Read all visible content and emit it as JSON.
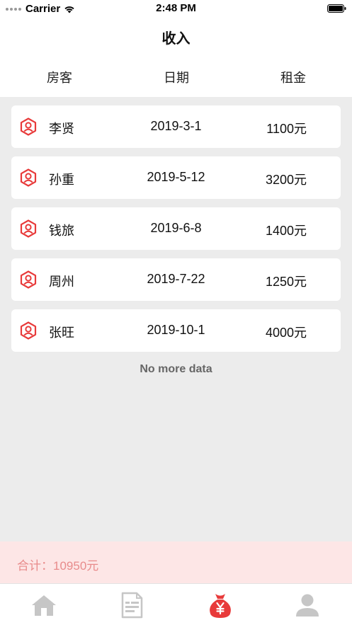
{
  "status_bar": {
    "carrier": "Carrier",
    "time": "2:48 PM"
  },
  "header": {
    "title": "收入",
    "columns": {
      "tenant": "房客",
      "date": "日期",
      "rent": "租金"
    }
  },
  "rows": [
    {
      "name": "李贤",
      "date": "2019-3-1",
      "amount": "1100元"
    },
    {
      "name": "孙重",
      "date": "2019-5-12",
      "amount": "3200元"
    },
    {
      "name": "钱旅",
      "date": "2019-6-8",
      "amount": "1400元"
    },
    {
      "name": "周州",
      "date": "2019-7-22",
      "amount": "1250元"
    },
    {
      "name": "张旺",
      "date": "2019-10-1",
      "amount": "4000元"
    }
  ],
  "list_footer": "No more data",
  "total": "合计：10950元",
  "colors": {
    "accent": "#e83a3a",
    "total_bg": "#fde6e6",
    "total_text": "#e88b8b",
    "page_bg": "#ececec"
  },
  "tabs": [
    {
      "icon": "home-icon",
      "active": false
    },
    {
      "icon": "document-icon",
      "active": false
    },
    {
      "icon": "money-bag-icon",
      "active": true
    },
    {
      "icon": "user-icon",
      "active": false
    }
  ]
}
